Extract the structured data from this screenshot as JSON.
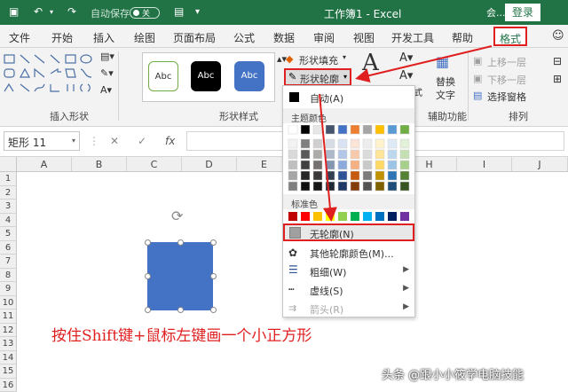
{
  "titlebar": {
    "autosave_label": "自动保存",
    "autosave_state": "关",
    "title": "工作簿1  -  Excel",
    "share": "会...",
    "login": "登录"
  },
  "tabs": [
    "文件",
    "开始",
    "插入",
    "绘图",
    "页面布局",
    "公式",
    "数据",
    "审阅",
    "视图",
    "开发工具",
    "帮助",
    "格式"
  ],
  "active_tab": "格式",
  "ribbon": {
    "insert_shapes_group": "插入形状",
    "shape_styles_group": "形状样式",
    "style_samples": [
      "Abc",
      "Abc",
      "Abc"
    ],
    "shape_fill": "形状填充",
    "shape_outline": "形状轮廓",
    "wordart_label": "艺术字样式",
    "alt_text_line1": "替换",
    "alt_text_line2": "文字",
    "accessibility_group": "辅助功能",
    "bring_forward": "上移一层",
    "send_backward": "下移一层",
    "selection_pane": "选择窗格",
    "arrange_group": "排列"
  },
  "formula_bar": {
    "name_box": "矩形 11",
    "fx": "fx",
    "cancel": "✕",
    "enter": "✓"
  },
  "columns": [
    "A",
    "B",
    "C",
    "D",
    "E",
    "F",
    "G",
    "H",
    "I",
    "J"
  ],
  "rows": [
    "1",
    "2",
    "3",
    "4",
    "5",
    "6",
    "7",
    "8",
    "9",
    "10",
    "11",
    "12",
    "13",
    "14",
    "15",
    "16"
  ],
  "dropdown": {
    "auto": "自动(A)",
    "theme_colors": "主题颜色",
    "standard_colors": "标准色",
    "no_outline": "无轮廓(N)",
    "more_colors": "其他轮廓颜色(M)...",
    "weight": "粗细(W)",
    "dashes": "虚线(S)",
    "arrows": "箭头(R)"
  },
  "theme_color_columns": [
    [
      "#ffffff",
      "#f2f2f2",
      "#d9d9d9",
      "#bfbfbf",
      "#a6a6a6",
      "#808080"
    ],
    [
      "#000000",
      "#7f7f7f",
      "#595959",
      "#404040",
      "#262626",
      "#0d0d0d"
    ],
    [
      "#e7e6e6",
      "#d0cece",
      "#aeaaaa",
      "#757171",
      "#3a3838",
      "#171616"
    ],
    [
      "#44546a",
      "#d6dce4",
      "#adb9ca",
      "#8496b0",
      "#333f4f",
      "#222a35"
    ],
    [
      "#4472c4",
      "#d9e2f3",
      "#b4c6e7",
      "#8eaadb",
      "#2f5496",
      "#1f3864"
    ],
    [
      "#ed7d31",
      "#fbe4d5",
      "#f7caac",
      "#f4b183",
      "#c55a11",
      "#833c0b"
    ],
    [
      "#a5a5a5",
      "#ededed",
      "#dbdbdb",
      "#c9c9c9",
      "#7b7b7b",
      "#525252"
    ],
    [
      "#ffc000",
      "#fff2cc",
      "#fee599",
      "#ffd966",
      "#bf9000",
      "#7f6000"
    ],
    [
      "#5b9bd5",
      "#deebf6",
      "#bdd7ee",
      "#9dc3e6",
      "#2e75b5",
      "#1f4e79"
    ],
    [
      "#70ad47",
      "#e2efd9",
      "#c5e0b3",
      "#a8d08d",
      "#538135",
      "#375623"
    ]
  ],
  "standard_colors": [
    "#c00000",
    "#ff0000",
    "#ffc000",
    "#ffff00",
    "#92d050",
    "#00b050",
    "#00b0f0",
    "#0070c0",
    "#002060",
    "#7030a0"
  ],
  "shape_fill_color": "#4472c4",
  "annotation": {
    "instruction": "按住Shift键+鼠标左键画一个小正方形",
    "color": "#e02020"
  },
  "watermark": "头条 @跟小小筱学电脑技能"
}
